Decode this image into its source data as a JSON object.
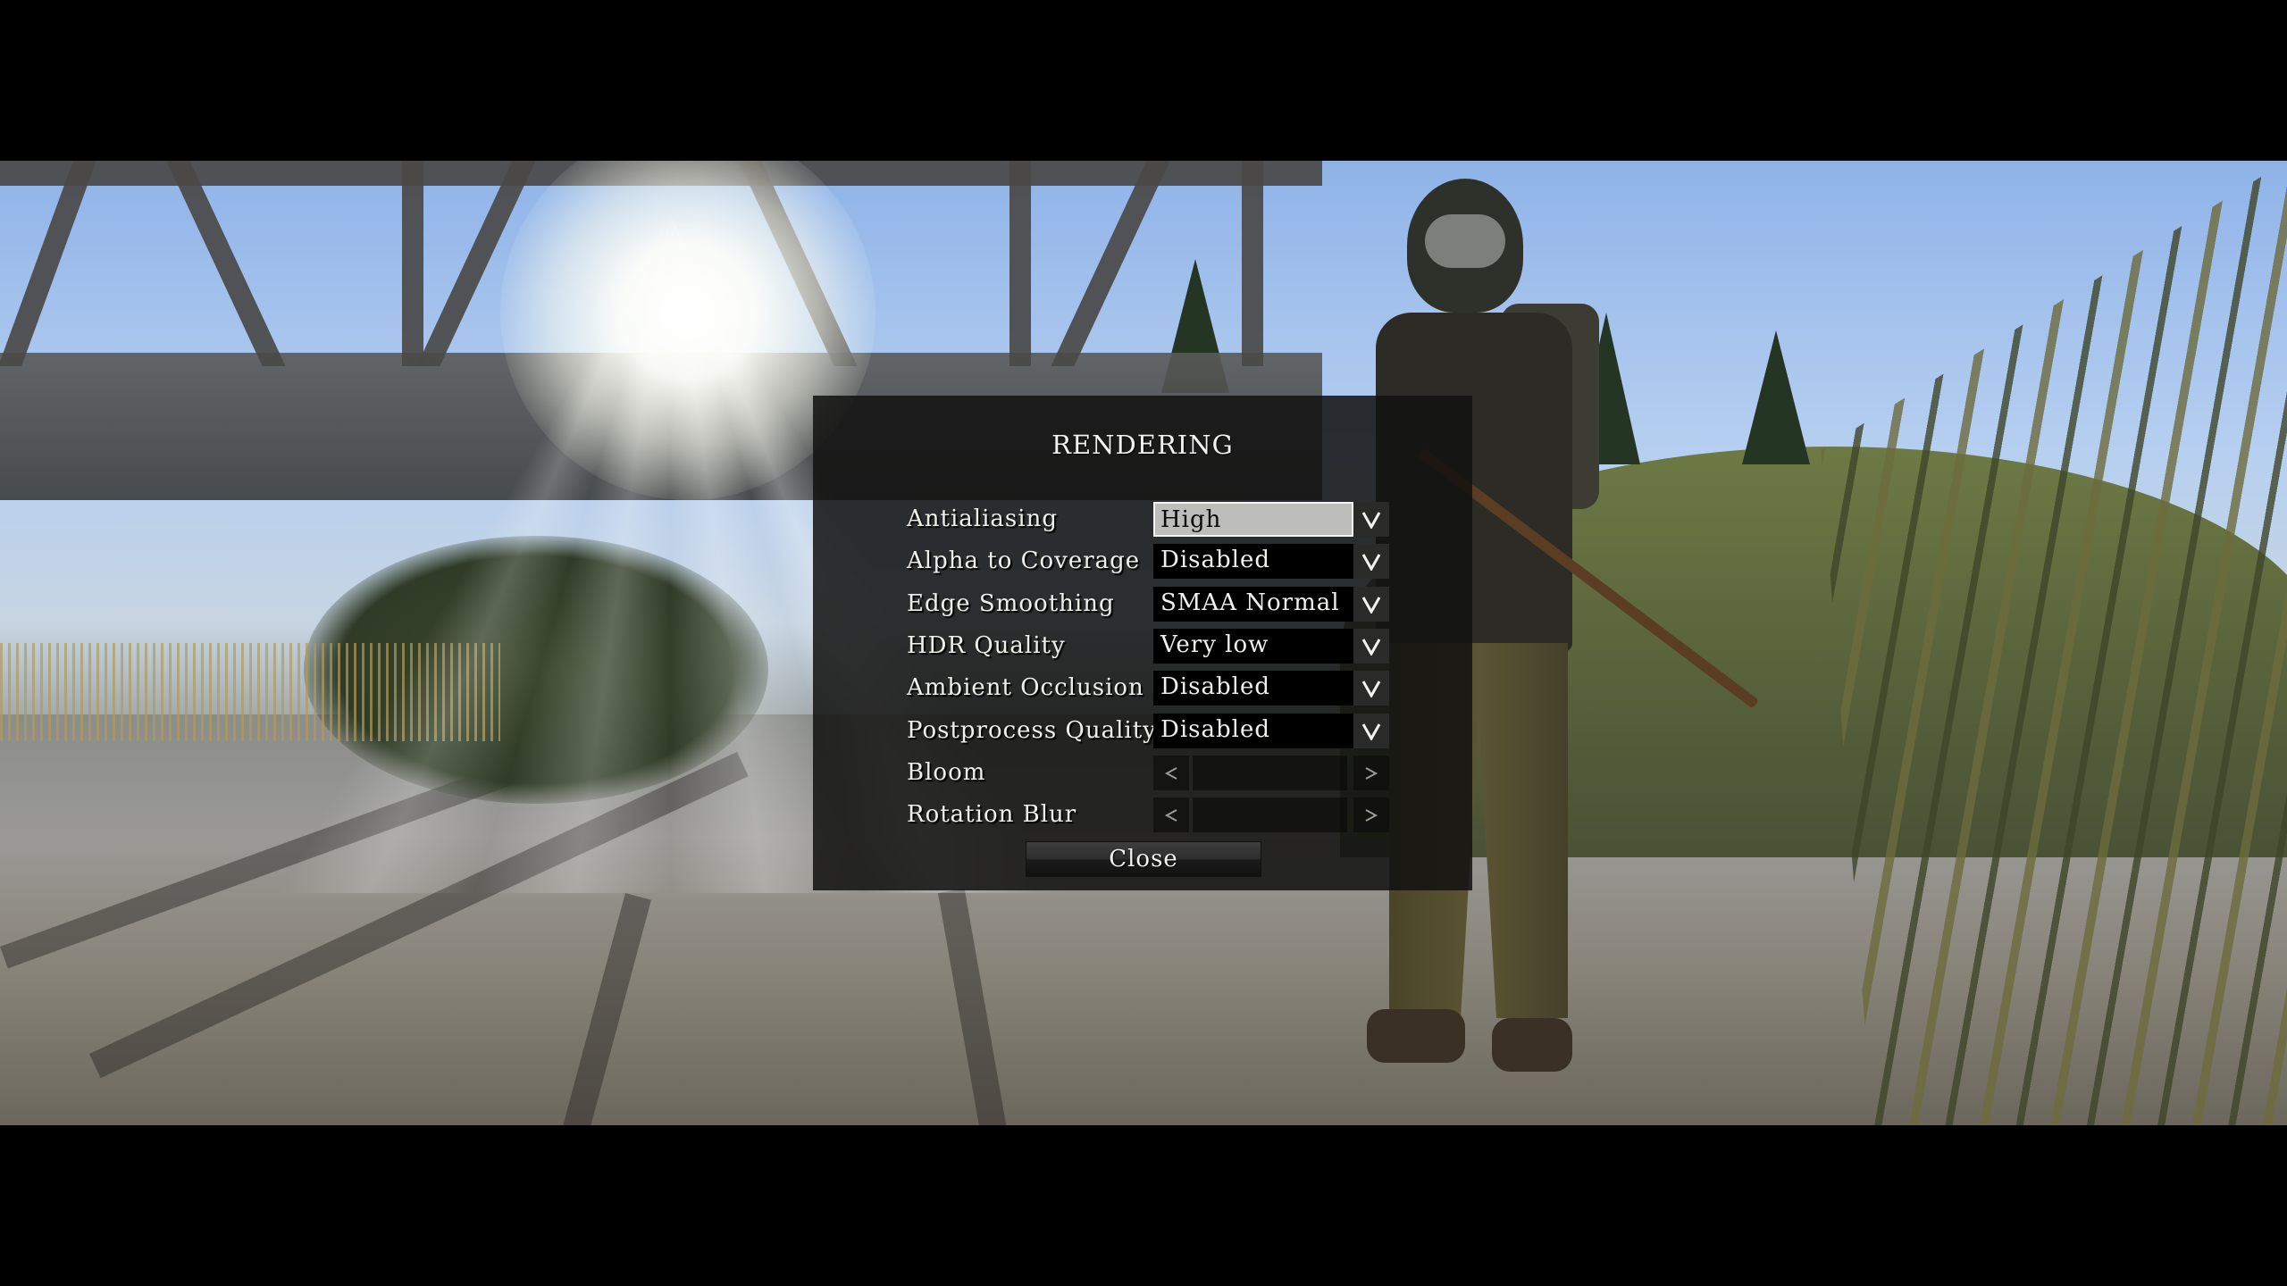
{
  "dialog": {
    "title": "RENDERING",
    "settings": [
      {
        "label": "Antialiasing",
        "type": "dropdown",
        "value": "High",
        "selected": true
      },
      {
        "label": "Alpha to Coverage",
        "type": "dropdown",
        "value": "Disabled"
      },
      {
        "label": "Edge Smoothing",
        "type": "dropdown",
        "value": "SMAA Normal"
      },
      {
        "label": "HDR Quality",
        "type": "dropdown",
        "value": "Very low"
      },
      {
        "label": "Ambient Occlusion",
        "type": "dropdown",
        "value": "Disabled"
      },
      {
        "label": "Postprocess Quality",
        "type": "dropdown",
        "value": "Disabled"
      },
      {
        "label": "Bloom",
        "type": "slider",
        "value": ""
      },
      {
        "label": "Rotation Blur",
        "type": "slider",
        "value": ""
      }
    ],
    "close_label": "Close"
  },
  "icons": {
    "dropdown": "chevron-down-icon",
    "slider_left": "chevron-left-icon",
    "slider_right": "chevron-right-icon"
  },
  "colors": {
    "selected_field_bg": "#bdbdbc",
    "field_bg": "#000000",
    "text": "#efefea",
    "dialog_bg": "#121110"
  }
}
